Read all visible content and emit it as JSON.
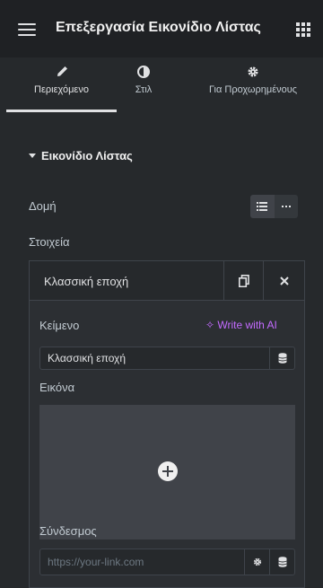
{
  "header": {
    "title": "Επεξεργασία Εικονίδιο Λίστας"
  },
  "tabs": [
    {
      "label": "Περιεχόμενο",
      "icon": "pencil-icon",
      "active": true
    },
    {
      "label": "Στιλ",
      "icon": "half-circle-icon",
      "active": false
    },
    {
      "label": "Για Προχωρημένους",
      "icon": "gear-icon",
      "active": false
    }
  ],
  "section": {
    "title": "Εικονίδιο Λίστας"
  },
  "layout": {
    "label": "Δομή",
    "options": [
      "list-icon",
      "more-icon"
    ],
    "selected": "list-icon"
  },
  "items": {
    "label": "Στοιχεία",
    "repeater_item_title": "Κλασσική εποχή"
  },
  "fields": {
    "text_label": "Κείμενο",
    "ai_button": "Write with AI",
    "text_value": "Κλασσική εποχή",
    "image_label": "Εικόνα",
    "link_label": "Σύνδεσμος",
    "link_placeholder": "https://your-link.com"
  },
  "colors": {
    "background": "#26292c",
    "header": "#1f2124",
    "ai_accent": "#c36bff",
    "image_placeholder": "#404349"
  }
}
